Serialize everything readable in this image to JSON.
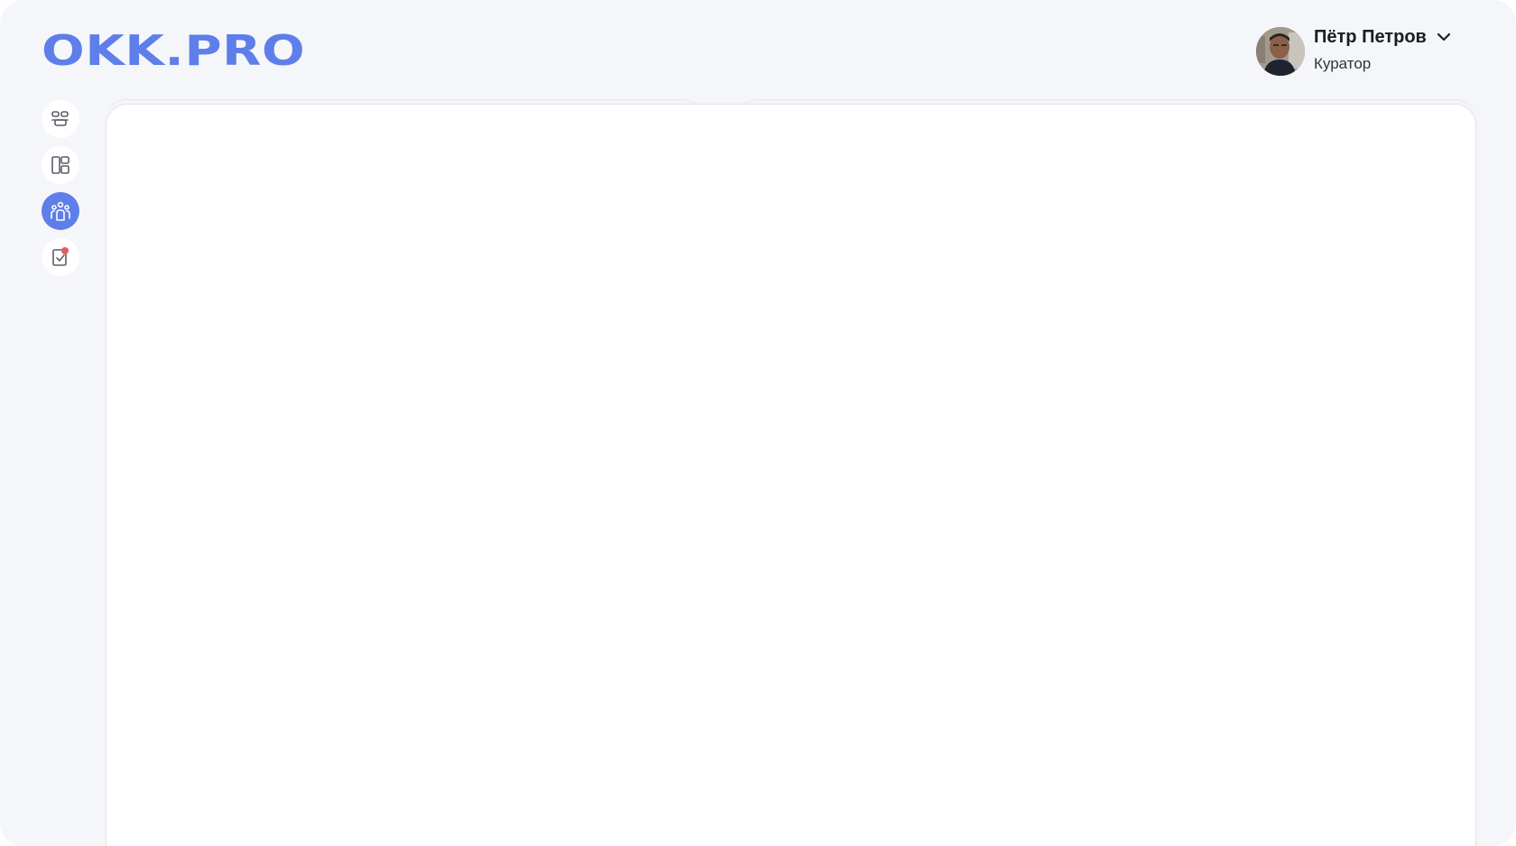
{
  "header": {
    "logo_text": "OKK.PRO"
  },
  "profile": {
    "name": "Пётр Петров",
    "role": "Куратор"
  },
  "sidebar": {
    "items": [
      {
        "icon": "people-grid-icon",
        "active": false
      },
      {
        "icon": "layout-icon",
        "active": false
      },
      {
        "icon": "team-icon",
        "active": true
      },
      {
        "icon": "checklist-icon",
        "active": false,
        "badge": true
      }
    ]
  },
  "colors": {
    "accent": "#5e7eea",
    "background": "#f5f6f9",
    "panel": "#ffffff",
    "badge": "#ea5a5a",
    "text": "#1b1d22"
  }
}
